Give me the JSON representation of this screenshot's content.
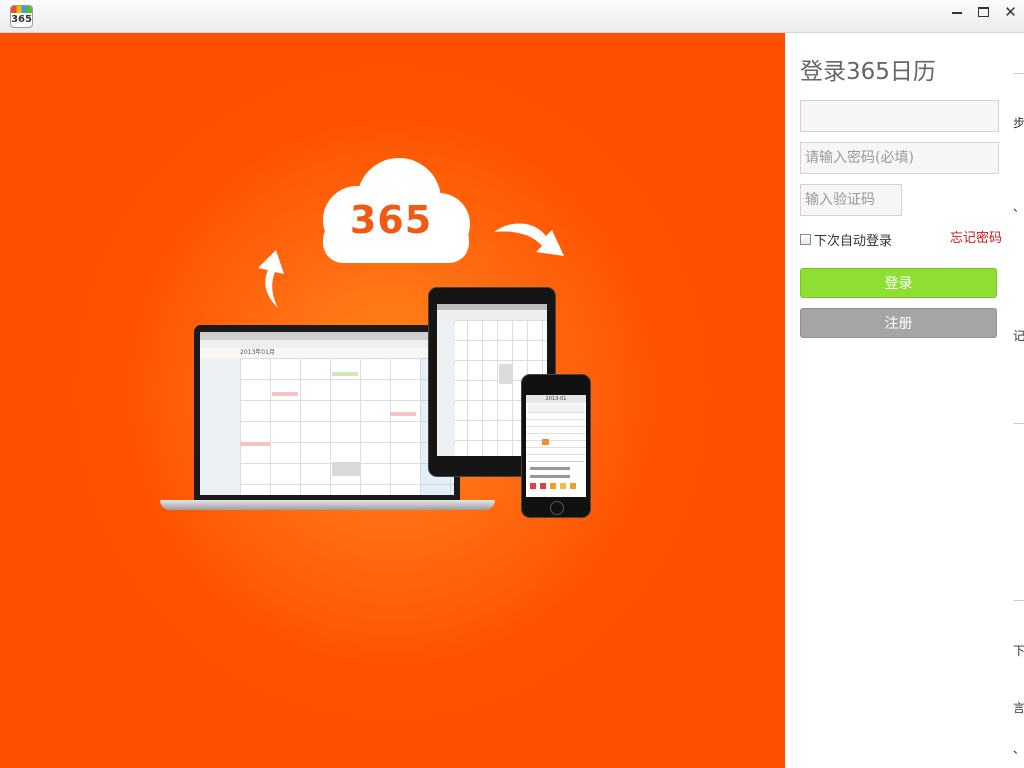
{
  "window": {
    "app_icon_text": "365",
    "controls": [
      "minimize",
      "maximize",
      "close"
    ]
  },
  "hero": {
    "cloud_text": "365",
    "laptop_header": "2013年01月",
    "phone_header": "2013-01",
    "colors": {
      "background": "#ff5500",
      "cloud": "#ffffff",
      "cloud_text": "#f05a14"
    }
  },
  "login": {
    "title": "登录365日历",
    "username_placeholder": "",
    "password_placeholder": "请输入密码(必填)",
    "captcha_placeholder": "输入验证码",
    "remember_label": "下次自动登录",
    "forgot_label": "忘记密码",
    "login_button": "登录",
    "register_button": "注册",
    "colors": {
      "login_button": "#8fde34",
      "register_button": "#a5a5a5",
      "forgot_link": "#d21414"
    }
  },
  "right_edge_fragments": [
    "步",
    "、",
    "记",
    "下",
    "言",
    "、"
  ]
}
